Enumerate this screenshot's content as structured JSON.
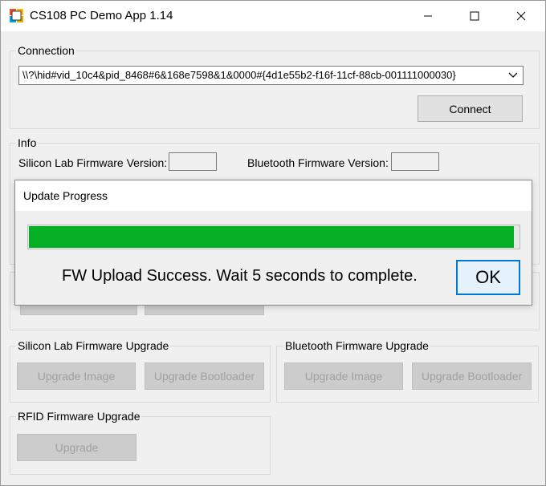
{
  "window": {
    "title": "CS108 PC Demo App 1.14",
    "minimize_icon": "minimize-icon",
    "maximize_icon": "maximize-icon",
    "close_icon": "close-icon"
  },
  "connection": {
    "group_label": "Connection",
    "device_path": "\\\\?\\hid#vid_10c4&pid_8468#6&168e7598&1&0000#{4d1e55b2-f16f-11cf-88cb-001111000030}",
    "connect_label": "Connect"
  },
  "info": {
    "group_label": "Info",
    "silicon_fw_label": "Silicon Lab Firmware Version:",
    "silicon_fw_value": "",
    "bluetooth_fw_label": "Bluetooth Firmware Version:",
    "bluetooth_fw_value": ""
  },
  "silicon_upgrade": {
    "group_label": "Silicon Lab Firmware Upgrade",
    "upgrade_image_label": "Upgrade Image",
    "upgrade_bootloader_label": "Upgrade Bootloader"
  },
  "bluetooth_upgrade": {
    "group_label": "Bluetooth Firmware Upgrade",
    "upgrade_image_label": "Upgrade Image",
    "upgrade_bootloader_label": "Upgrade Bootloader"
  },
  "rfid_upgrade": {
    "group_label": "RFID Firmware Upgrade",
    "upgrade_label": "Upgrade"
  },
  "dialog": {
    "title": "Update Progress",
    "progress_fraction": 0.99,
    "message": "FW Upload Success. Wait 5 seconds to complete.",
    "ok_label": "OK"
  },
  "colors": {
    "progress_fill": "#06b025",
    "ok_border": "#0078d7"
  }
}
